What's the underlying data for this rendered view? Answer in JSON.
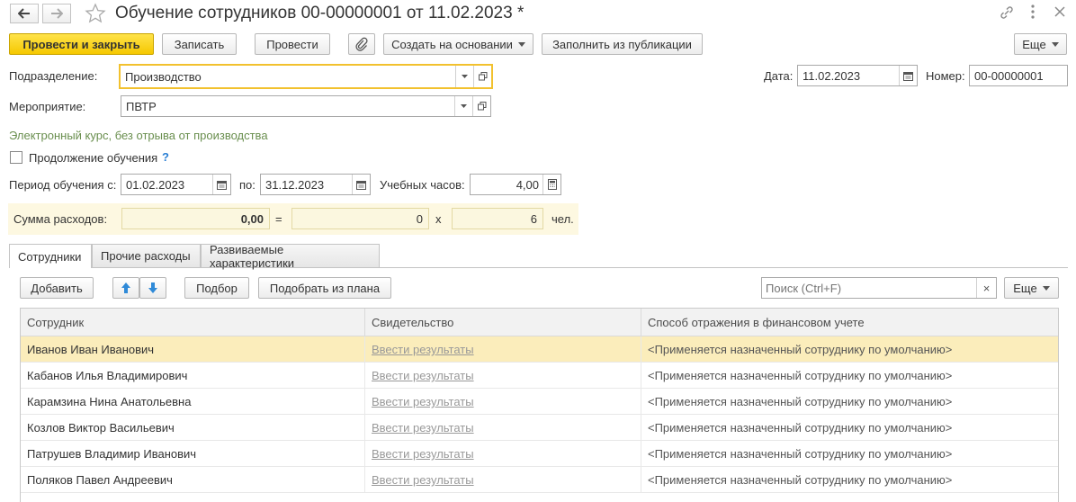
{
  "window": {
    "title": "Обучение сотрудников 00-00000001 от 11.02.2023 *"
  },
  "toolbar": {
    "post_close": "Провести и закрыть",
    "save": "Записать",
    "post": "Провести",
    "create_based": "Создать на основании",
    "fill_publication": "Заполнить из публикации",
    "more": "Еще"
  },
  "form": {
    "department_label": "Подразделение:",
    "department_value": "Производство",
    "event_label": "Мероприятие:",
    "event_value": "ПВТР",
    "date_label": "Дата:",
    "date_value": "11.02.2023",
    "number_label": "Номер:",
    "number_value": "00-00000001",
    "course_info": "Электронный курс, без отрыва от производства",
    "continuation_label": "Продолжение обучения",
    "help_mark": "?",
    "period_label": "Период обучения с:",
    "period_from": "01.02.2023",
    "period_to_label": "по:",
    "period_to": "31.12.2023",
    "hours_label": "Учебных часов:",
    "hours_value": "4,00"
  },
  "expenses": {
    "label": "Сумма расходов:",
    "total": "0,00",
    "eq": "=",
    "per_person": "0",
    "times": "x",
    "people": "6",
    "unit": "чел."
  },
  "tabs": [
    {
      "label": "Сотрудники"
    },
    {
      "label": "Прочие расходы"
    },
    {
      "label": "Развиваемые характеристики"
    }
  ],
  "table_toolbar": {
    "add": "Добавить",
    "pick": "Подбор",
    "pick_plan": "Подобрать из плана",
    "search_placeholder": "Поиск (Ctrl+F)",
    "clear": "×",
    "more": "Еще"
  },
  "table": {
    "columns": [
      "Сотрудник",
      "Свидетельство",
      "Способ отражения в финансовом учете"
    ],
    "rows": [
      {
        "employee": "Иванов Иван Иванович",
        "certificate": "Ввести результаты",
        "method": "<Применяется назначенный сотруднику по умолчанию>"
      },
      {
        "employee": "Кабанов Илья Владимирович",
        "certificate": "Ввести результаты",
        "method": "<Применяется назначенный сотруднику по умолчанию>"
      },
      {
        "employee": "Карамзина Нина Анатольевна",
        "certificate": "Ввести результаты",
        "method": "<Применяется назначенный сотруднику по умолчанию>"
      },
      {
        "employee": "Козлов Виктор Васильевич",
        "certificate": "Ввести результаты",
        "method": "<Применяется назначенный сотруднику по умолчанию>"
      },
      {
        "employee": "Патрушев Владимир Иванович",
        "certificate": "Ввести результаты",
        "method": "<Применяется назначенный сотруднику по умолчанию>"
      },
      {
        "employee": "Поляков Павел Андреевич",
        "certificate": "Ввести результаты",
        "method": "<Применяется назначенный сотруднику по умолчанию>"
      }
    ]
  },
  "colors": {
    "accent_yellow": "#f5c800",
    "selected_row": "#fbedbb",
    "expenses_bg": "#fdf8e1",
    "course_info_text": "#6a8f4f",
    "help_blue": "#2a7fd4"
  }
}
